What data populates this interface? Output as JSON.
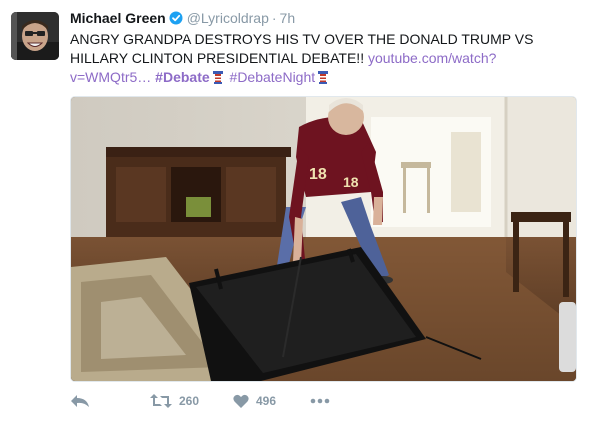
{
  "tweet": {
    "author_name": "Michael Green",
    "handle": "@Lyricoldrap",
    "separator": "·",
    "time": "7h",
    "text_line1": "ANGRY GRANDPA DESTROYS HIS TV OVER THE DONALD TRUMP VS",
    "text_line2": "HILLARY CLINTON PRESIDENTIAL DEBATE!!",
    "link_part1": "youtube.com/watch?",
    "link_part2": "v=WMQtr5…",
    "hashtag1": "#Debate",
    "hashtag2": "#DebateNight",
    "icons": {
      "avatar": "avatar-photo",
      "verified": "verified-badge-icon",
      "emoji": "podium-emoji-icon",
      "reply": "reply-icon",
      "retweet": "retweet-icon",
      "like": "heart-icon",
      "more": "more-dots-icon"
    }
  },
  "actions": {
    "retweet_count": "260",
    "like_count": "496"
  },
  "colors": {
    "link": "#8d6bc7",
    "meta": "#8899a6",
    "verified": "#1da1f2",
    "text": "#14171a"
  }
}
